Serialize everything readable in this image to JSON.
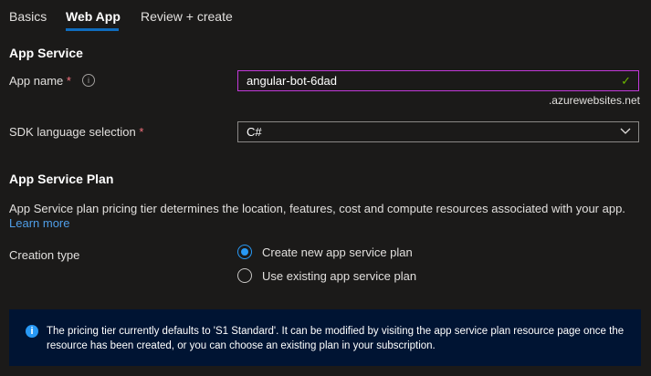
{
  "tabs": [
    {
      "label": "Basics"
    },
    {
      "label": "Web App"
    },
    {
      "label": "Review + create"
    }
  ],
  "app_service": {
    "heading": "App Service",
    "app_name_label": "App name",
    "app_name_value": "angular-bot-6dad",
    "domain_suffix": ".azurewebsites.net",
    "sdk_label": "SDK language selection",
    "sdk_value": "C#",
    "required_mark": "*"
  },
  "plan": {
    "heading": "App Service Plan",
    "description": "App Service plan pricing tier determines the location, features, cost and compute resources associated with your app.",
    "learn_more": "Learn more",
    "creation_type_label": "Creation type",
    "options": [
      {
        "label": "Create new app service plan",
        "selected": true
      },
      {
        "label": "Use existing app service plan",
        "selected": false
      }
    ]
  },
  "info_banner": {
    "text": "The pricing tier currently defaults to 'S1 Standard'. It can be modified by visiting the app service plan resource page once the resource has been created, or you can choose an existing plan in your subscription."
  }
}
